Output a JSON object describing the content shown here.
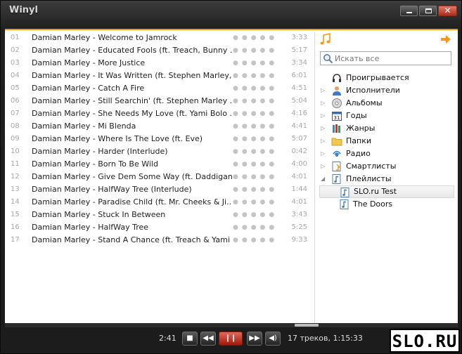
{
  "app": {
    "title": "Winyl"
  },
  "tracks": [
    {
      "num": "01",
      "title": "Damian Marley - Welcome to Jamrock",
      "duration": "3:33"
    },
    {
      "num": "02",
      "title": "Damian Marley - Educated Fools (ft. Treach, Bunny ...",
      "duration": "5:17"
    },
    {
      "num": "03",
      "title": "Damian Marley - More Justice",
      "duration": "3:34"
    },
    {
      "num": "04",
      "title": "Damian Marley - It Was Written (ft. Stephen Marley, ...",
      "duration": "6:01"
    },
    {
      "num": "05",
      "title": "Damian Marley - Catch A Fire",
      "duration": "4:51"
    },
    {
      "num": "06",
      "title": "Damian Marley - Still Searchin' (ft. Stephen Marley ...",
      "duration": "5:04"
    },
    {
      "num": "07",
      "title": "Damian Marley - She Needs My Love (ft. Yami Bolo ...",
      "duration": "4:16"
    },
    {
      "num": "08",
      "title": "Damian Marley - Mi Blenda",
      "duration": "4:41"
    },
    {
      "num": "09",
      "title": "Damian Marley - Where Is The Love (ft. Eve)",
      "duration": "5:07"
    },
    {
      "num": "10",
      "title": "Damian Marley - Harder (Interlude)",
      "duration": "0:42"
    },
    {
      "num": "11",
      "title": "Damian Marley - Born To Be Wild",
      "duration": "4:00"
    },
    {
      "num": "12",
      "title": "Damian Marley - Give Dem Some Way (ft. Daddigan)",
      "duration": "4:01"
    },
    {
      "num": "13",
      "title": "Damian Marley - HalfWay Tree (Interlude)",
      "duration": "1:44"
    },
    {
      "num": "14",
      "title": "Damian Marley - Paradise Child (ft. Mr. Cheeks & Ji...",
      "duration": "4:01"
    },
    {
      "num": "15",
      "title": "Damian Marley - Stuck In Between",
      "duration": "3:43"
    },
    {
      "num": "16",
      "title": "Damian Marley - HalfWay Tree",
      "duration": "5:25"
    },
    {
      "num": "17",
      "title": "Damian Marley - Stand A Chance (ft. Treach & Yami ...",
      "duration": "9:33"
    }
  ],
  "rating_glyph": "●●●●●",
  "search": {
    "placeholder": "Искать все"
  },
  "library": {
    "items": [
      {
        "label": "Проигрывается",
        "icon": "headphones-icon"
      },
      {
        "label": "Исполнители",
        "icon": "person-icon"
      },
      {
        "label": "Альбомы",
        "icon": "cd-icon"
      },
      {
        "label": "Годы",
        "icon": "calendar-icon"
      },
      {
        "label": "Жанры",
        "icon": "books-icon"
      },
      {
        "label": "Папки",
        "icon": "folder-icon"
      },
      {
        "label": "Радио",
        "icon": "radio-icon"
      },
      {
        "label": "Смартлисты",
        "icon": "smartlist-icon"
      },
      {
        "label": "Плейлисты",
        "icon": "playlist-icon"
      }
    ],
    "calendar_day": "31",
    "playlists": [
      {
        "label": "SLO.ru Test",
        "selected": true
      },
      {
        "label": "The Doors",
        "selected": false
      }
    ]
  },
  "player": {
    "elapsed": "2:41",
    "summary": "17 треков, 1:15:33",
    "state": "playing"
  },
  "watermark": {
    "text": "SLO.RU"
  },
  "colors": {
    "accent": "#f39a1e",
    "pause_button": "#c0281a"
  }
}
